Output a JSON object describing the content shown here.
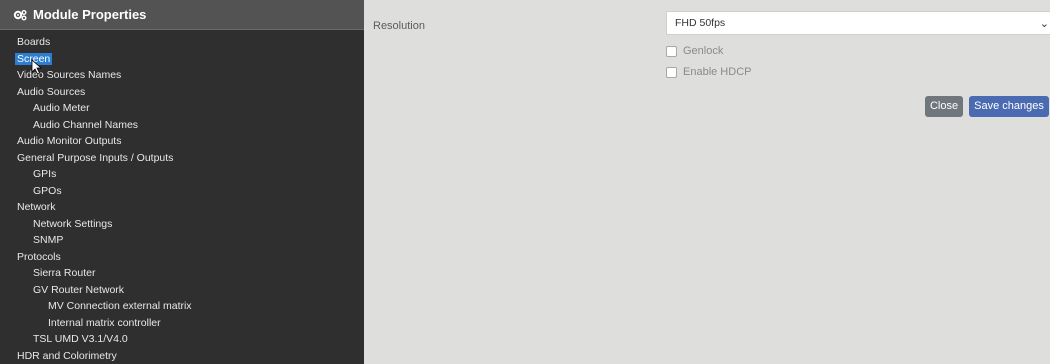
{
  "sidebar": {
    "title": "Module Properties",
    "items": [
      {
        "label": "Boards",
        "level": 0
      },
      {
        "label": "Screen",
        "level": 0,
        "selected": true
      },
      {
        "label": "Video Sources Names",
        "level": 0
      },
      {
        "label": "Audio Sources",
        "level": 0
      },
      {
        "label": "Audio Meter",
        "level": 1
      },
      {
        "label": "Audio Channel Names",
        "level": 1
      },
      {
        "label": "Audio Monitor Outputs",
        "level": 0
      },
      {
        "label": "General Purpose Inputs / Outputs",
        "level": 0
      },
      {
        "label": "GPIs",
        "level": 1
      },
      {
        "label": "GPOs",
        "level": 1
      },
      {
        "label": "Network",
        "level": 0
      },
      {
        "label": "Network Settings",
        "level": 1
      },
      {
        "label": "SNMP",
        "level": 1
      },
      {
        "label": "Protocols",
        "level": 0
      },
      {
        "label": "Sierra Router",
        "level": 1
      },
      {
        "label": "GV Router Network",
        "level": 1
      },
      {
        "label": "MV Connection external matrix",
        "level": 2
      },
      {
        "label": "Internal matrix controller",
        "level": 2
      },
      {
        "label": "TSL UMD V3.1/V4.0",
        "level": 1
      },
      {
        "label": "HDR and Colorimetry",
        "level": 0
      }
    ]
  },
  "form": {
    "resolution_label": "Resolution",
    "resolution_value": "FHD 50fps",
    "genlock_label": "Genlock",
    "genlock_checked": false,
    "hdcp_label": "Enable HDCP",
    "hdcp_checked": false,
    "close_label": "Close",
    "save_label": "Save changes"
  },
  "colors": {
    "sidebar_bg": "#2f2f2f",
    "sidebar_header_bg": "#535353",
    "selected_bg": "#2c7fd0",
    "save_button": "#4a6bb1",
    "close_button": "#6f777d"
  }
}
